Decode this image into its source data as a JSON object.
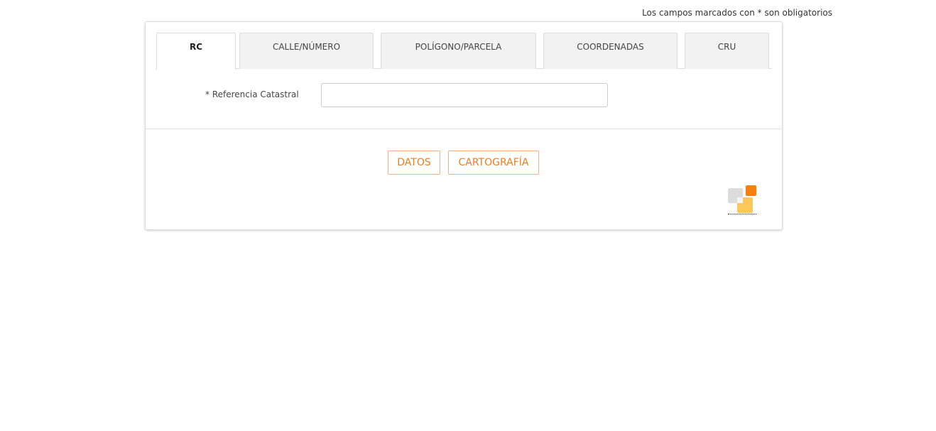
{
  "required_note": "Los campos marcados con * son obligatorios",
  "tabs": [
    {
      "label": "RC",
      "active": true
    },
    {
      "label": "CALLE/NÚMERO",
      "active": false
    },
    {
      "label": "POLÍGONO/PARCELA",
      "active": false
    },
    {
      "label": "COORDENADAS",
      "active": false
    },
    {
      "label": "CRU",
      "active": false
    }
  ],
  "form": {
    "field_label": "* Referencia Catastral",
    "field_value": "",
    "field_placeholder": ""
  },
  "buttons": {
    "datos": "DATOS",
    "cartografia": "CARTOGRAFÍA"
  },
  "colors": {
    "accent": "#ef7d1a",
    "button_border": "#f4b183",
    "logo_orange": "#f77f0e",
    "logo_yellow": "#fcc85a",
    "logo_gray": "#dcdcdc"
  },
  "icons": {
    "logo": "catastro-logo-icon"
  }
}
